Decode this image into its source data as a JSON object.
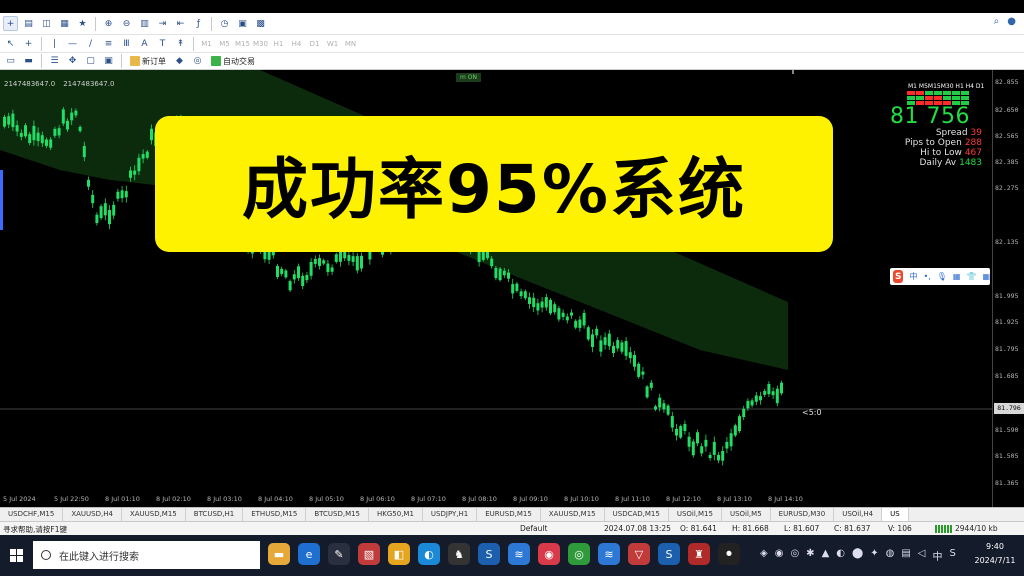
{
  "toolbar": {
    "timeframes": [
      "M1",
      "M5",
      "M15",
      "M30",
      "H1",
      "H4",
      "D1",
      "W1",
      "MN"
    ],
    "new_order_label": "新订单",
    "auto_trading_label": "自动交易"
  },
  "chart": {
    "top_left_values": [
      "2147483647.0",
      "2147483647.0"
    ],
    "top_tag": "m ON",
    "ask_label": "<5:0",
    "current_price": "81.796",
    "price_ticks": [
      "82.855",
      "82.650",
      "82.565",
      "82.385",
      "82.275",
      "82.135",
      "81.995",
      "81.925",
      "81.795",
      "81.685",
      "81.590",
      "81.505",
      "81.365"
    ],
    "time_ticks": [
      "5 Jul 2024",
      "5 Jul 22:50",
      "8 Jul 01:10",
      "8 Jul 02:10",
      "8 Jul 03:10",
      "8 Jul 04:10",
      "8 Jul 05:10",
      "8 Jul 06:10",
      "8 Jul 07:10",
      "8 Jul 08:10",
      "8 Jul 09:10",
      "8 Jul 10:10",
      "8 Jul 11:10",
      "8 Jul 12:10",
      "8 Jul 13:10",
      "8 Jul 14:10"
    ]
  },
  "indicator": {
    "timeframes_header": "M1 M5M15M30 H1 H4 D1",
    "price": "81 756",
    "lines": [
      {
        "label": "Spread",
        "value": "39",
        "color": "red"
      },
      {
        "label": "Pips to Open",
        "value": "288",
        "color": "red"
      },
      {
        "label": "Hi to Low",
        "value": "467",
        "color": "red"
      },
      {
        "label": "Daily Av",
        "value": "1483",
        "color": "green"
      }
    ]
  },
  "banner": {
    "text": "成功率95%系统"
  },
  "ime": {
    "logo": "S",
    "mode": "中"
  },
  "tabs": [
    "USDCHF,M15",
    "XAUUSD,H4",
    "XAUUSD,M15",
    "BTCUSD,H1",
    "ETHUSD,M15",
    "BTCUSD,M15",
    "HKG50,M1",
    "USDJPY,H1",
    "EURUSD,M15",
    "XAUUSD,M15",
    "USDCAD,M15",
    "USOil,M15",
    "USOil,M5",
    "EURUSD,M30",
    "USOil,H4",
    "US"
  ],
  "status": {
    "help": "寻求帮助,请按F1键",
    "profile": "Default",
    "datetime": "2024.07.08 13:25",
    "open": "O: 81.641",
    "high": "H: 81.668",
    "low": "L: 81.607",
    "close": "C: 81.637",
    "volume": "V: 106",
    "traffic": "2944/10 kb"
  },
  "taskbar": {
    "search_placeholder": "在此键入进行搜索",
    "time": "9:40",
    "date": "2024/7/11",
    "ime_indicator": "中"
  },
  "colors": {
    "bull": "#22dd66",
    "bear": "#0c2a0c",
    "banner": "#fff200",
    "indicator_price": "#22dd44"
  }
}
